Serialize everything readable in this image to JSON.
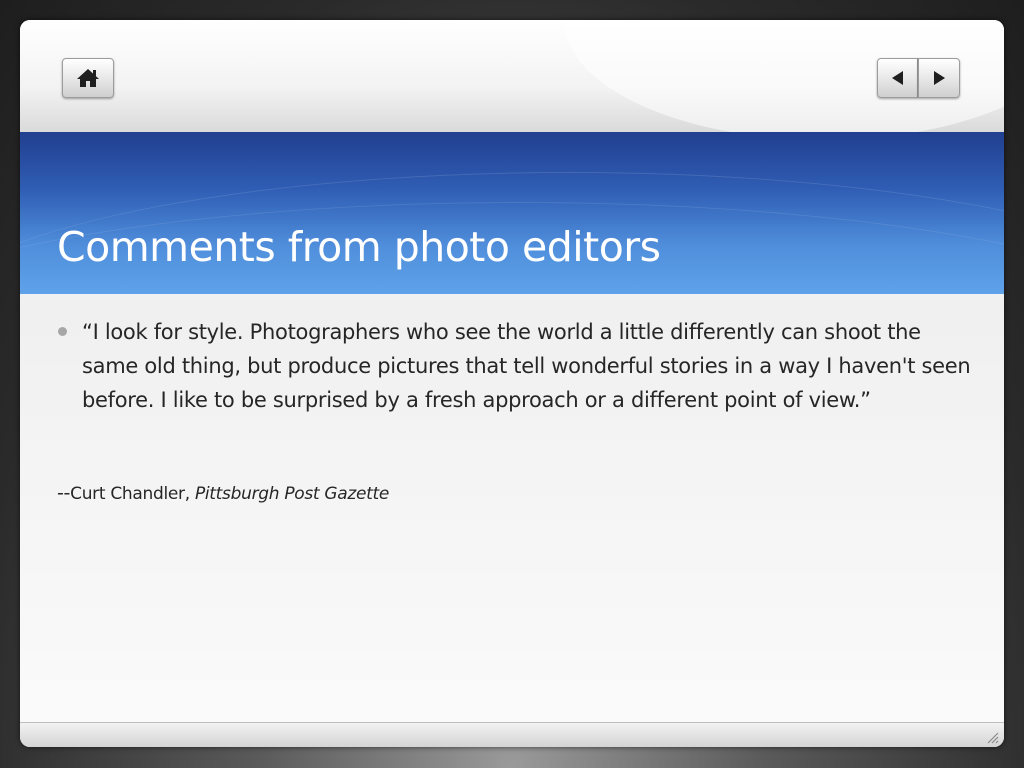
{
  "toolbar": {
    "home_icon": "home-icon",
    "prev_icon": "triangle-left-icon",
    "next_icon": "triangle-right-icon"
  },
  "slide": {
    "title": "Comments from photo editors",
    "quote": "“I look for style. Photographers who see the world a little differently can shoot the same old thing, but produce pictures that tell wonderful stories in a way I haven't seen before. I like to be surprised by a fresh approach or a different point of view.”",
    "attribution": {
      "dash": "--",
      "name": "Curt Chandler, ",
      "publication": "Pittsburgh Post Gazette"
    }
  },
  "colors": {
    "title_band_top": "#213f90",
    "title_band_bottom": "#5fa2ea",
    "title_text": "#ffffff",
    "body_text": "#262626",
    "bullet": "#a6a6a6"
  }
}
